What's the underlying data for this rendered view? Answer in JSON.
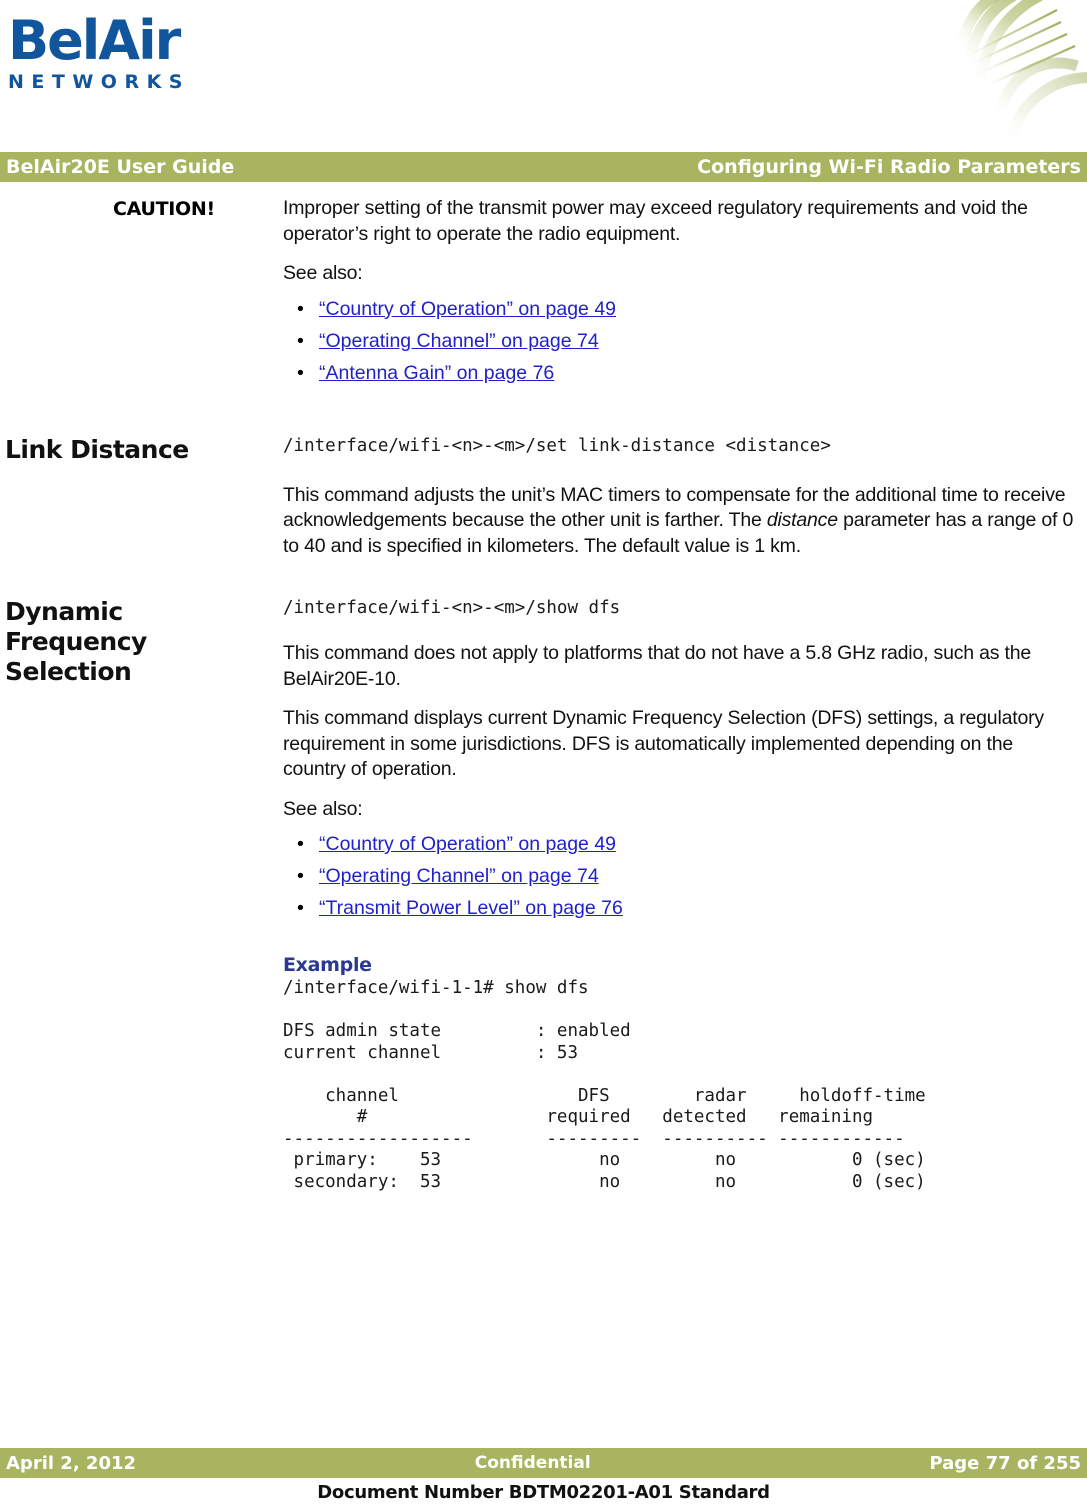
{
  "brand": {
    "logo_wordmark": "BelAir",
    "logo_subtext": "NETWORKS",
    "logo_color": "#11569C",
    "accent_color": "#A8B45F",
    "link_color": "#2020CC",
    "example_heading_color": "#2B3990"
  },
  "header": {
    "left": "BelAir20E User Guide",
    "right": "Configuring Wi-Fi Radio Parameters"
  },
  "caution": {
    "label": "CAUTION!",
    "paragraph": "Improper setting of the transmit power may exceed regulatory requirements and void the operator’s right to operate the radio equipment.",
    "see_also_label": "See also:",
    "links": [
      {
        "bullet": "•",
        "text": "“Country of Operation” on page 49"
      },
      {
        "bullet": "•",
        "text": "“Operating Channel” on page 74"
      },
      {
        "bullet": "•",
        "text": "“Antenna Gain” on page 76"
      }
    ]
  },
  "link_distance": {
    "heading": "Link Distance",
    "command": "/interface/wifi-<n>-<m>/set link-distance <distance>",
    "paragraph_part1": "This command adjusts the unit’s MAC timers to compensate for the additional time to receive acknowledgements because the other unit is farther. The ",
    "paragraph_italic": "distance",
    "paragraph_part2": " parameter has a range of 0 to 40 and is specified in kilometers. The default value is 1 km."
  },
  "dfs": {
    "heading_line1": "Dynamic",
    "heading_line2": "Frequency",
    "heading_line3": "Selection",
    "command": "/interface/wifi-<n>-<m>/show dfs",
    "paragraph1": "This command does not apply to platforms that do not have a 5.8 GHz radio, such as the BelAir20E-10.",
    "paragraph2": "This command displays current Dynamic Frequency Selection (DFS) settings, a regulatory requirement in some jurisdictions. DFS is automatically implemented depending on the country of operation.",
    "see_also_label": "See also:",
    "links": [
      {
        "bullet": "•",
        "text": "“Country of Operation” on page 49"
      },
      {
        "bullet": "•",
        "text": "“Operating Channel” on page 74"
      },
      {
        "bullet": "•",
        "text": "“Transmit Power Level” on page 76"
      }
    ],
    "example_heading": "Example",
    "example_output": "/interface/wifi-1-1# show dfs\n\nDFS admin state         : enabled\ncurrent channel         : 53\n\n    channel                 DFS        radar     holdoff-time\n       #                 required   detected   remaining\n------------------       ---------  ---------- ------------\n primary:    53               no         no           0 (sec)\n secondary:  53               no         no           0 (sec)"
  },
  "cli_table": {
    "prompt": "/interface/wifi-1-1# show dfs",
    "fields": [
      {
        "name": "DFS admin state",
        "value": "enabled"
      },
      {
        "name": "current channel",
        "value": "53"
      }
    ],
    "columns": [
      "channel #",
      "DFS required",
      "radar detected",
      "holdoff-time remaining"
    ],
    "rows": [
      {
        "label": "primary:",
        "channel": "53",
        "dfs_required": "no",
        "radar_detected": "no",
        "holdoff_time": "0 (sec)"
      },
      {
        "label": "secondary:",
        "channel": "53",
        "dfs_required": "no",
        "radar_detected": "no",
        "holdoff_time": "0 (sec)"
      }
    ]
  },
  "footer": {
    "date": "April 2, 2012",
    "classification": "Confidential",
    "page": "Page 77 of 255",
    "document_number": "Document Number BDTM02201-A01 Standard"
  }
}
